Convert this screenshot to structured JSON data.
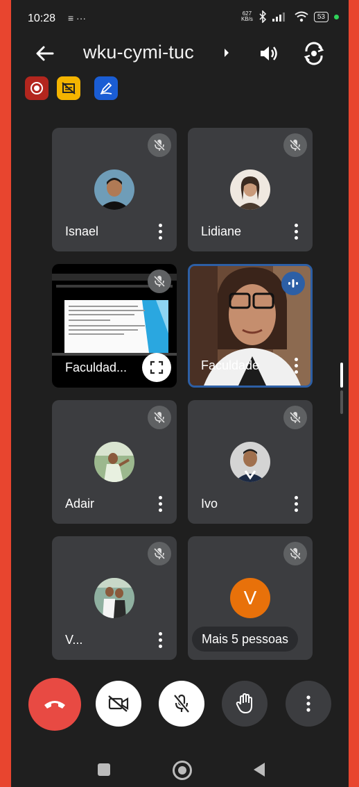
{
  "status_bar": {
    "time": "10:28",
    "extra_icons": "≡ ···",
    "net_speed_top": "627",
    "net_speed_bottom": "KB/s",
    "battery": "53"
  },
  "header": {
    "meeting_code": "wku-cymi-tuc"
  },
  "tiles": [
    {
      "name": "Isnael"
    },
    {
      "name": "Lidiane"
    },
    {
      "name": "Faculdad..."
    },
    {
      "name": "Faculdade"
    },
    {
      "name": "Adair"
    },
    {
      "name": "Ivo"
    },
    {
      "name": "V..."
    },
    {
      "name": "Mais 5 pessoas",
      "avatar_letter": "V"
    }
  ],
  "colors": {
    "frame": "#e8452f",
    "background": "#1f1f1f",
    "tile": "#3c3d40",
    "end_call": "#e84a43",
    "speaking_border": "#2d5fa5",
    "orange_avatar": "#e8710a"
  }
}
